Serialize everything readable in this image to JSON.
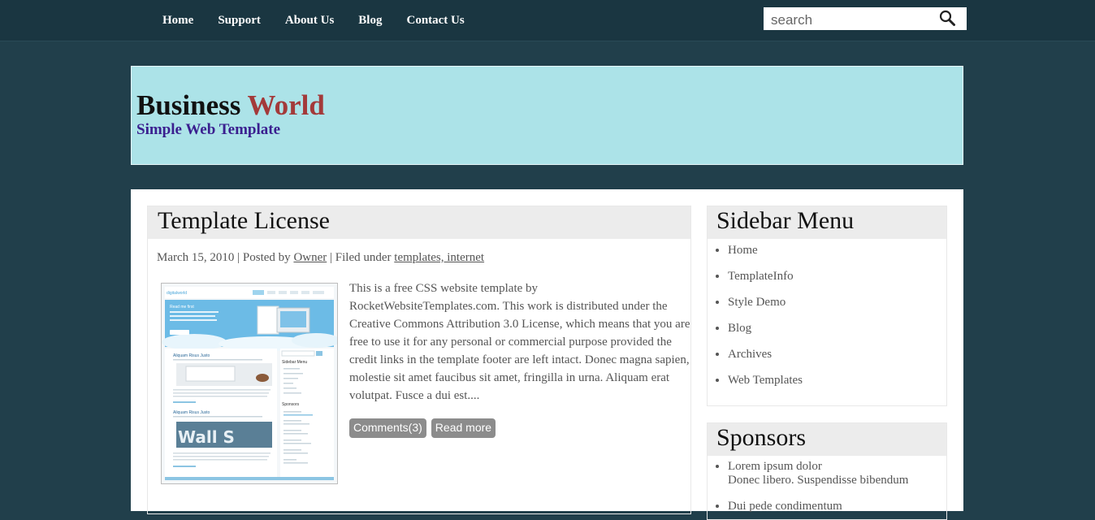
{
  "nav": {
    "items": [
      "Home",
      "Support",
      "About Us",
      "Blog",
      "Contact Us"
    ]
  },
  "search": {
    "placeholder": "search"
  },
  "header": {
    "brand_part1": "Business",
    "brand_part2": "World",
    "tagline": "Simple Web Template"
  },
  "post": {
    "title": "Template License",
    "date": "March 15, 2010",
    "posted_by": "Posted by",
    "author": "Owner",
    "filed_under": "Filed under",
    "categories": "templates, internet",
    "body": "This is a free CSS website template by RocketWebsiteTemplates.com. This work is distributed under the Creative Commons Attribution 3.0 License, which means that you are free to use it for any personal or commercial purpose provided the credit links in the template footer are left intact. Donec magna sapien, molestie sit amet faucibus sit amet, fringilla in urna. Aliquam erat volutpat. Fusce a dui est....",
    "comments_label": "Comments(3)",
    "read_more_label": "Read more",
    "thumbnail": {
      "site_name": "digitalworld",
      "banner_text": "Read me first",
      "article1": "Aliquam Risus Justo",
      "article2": "Aliquam Risus Justo",
      "sidebar_title": "Sidebar Menu",
      "sponsors_title": "Sponsors"
    }
  },
  "sidebar_menu": {
    "title": "Sidebar Menu",
    "items": [
      "Home",
      "TemplateInfo",
      "Style Demo",
      "Blog",
      "Archives",
      "Web Templates"
    ]
  },
  "sponsors": {
    "title": "Sponsors",
    "items": [
      {
        "line1": "Lorem ipsum dolor",
        "line2": "Donec libero. Suspendisse bibendum"
      },
      {
        "line1": "Dui pede condimentum",
        "line2": ""
      }
    ]
  },
  "colors": {
    "page_bg": "#213f4b",
    "topbar_bg": "#1a3641",
    "header_bg": "#ace3e8",
    "brand_accent": "#a33a3a",
    "tagline": "#3a1f8f",
    "button_bg": "#8c8c8c"
  }
}
